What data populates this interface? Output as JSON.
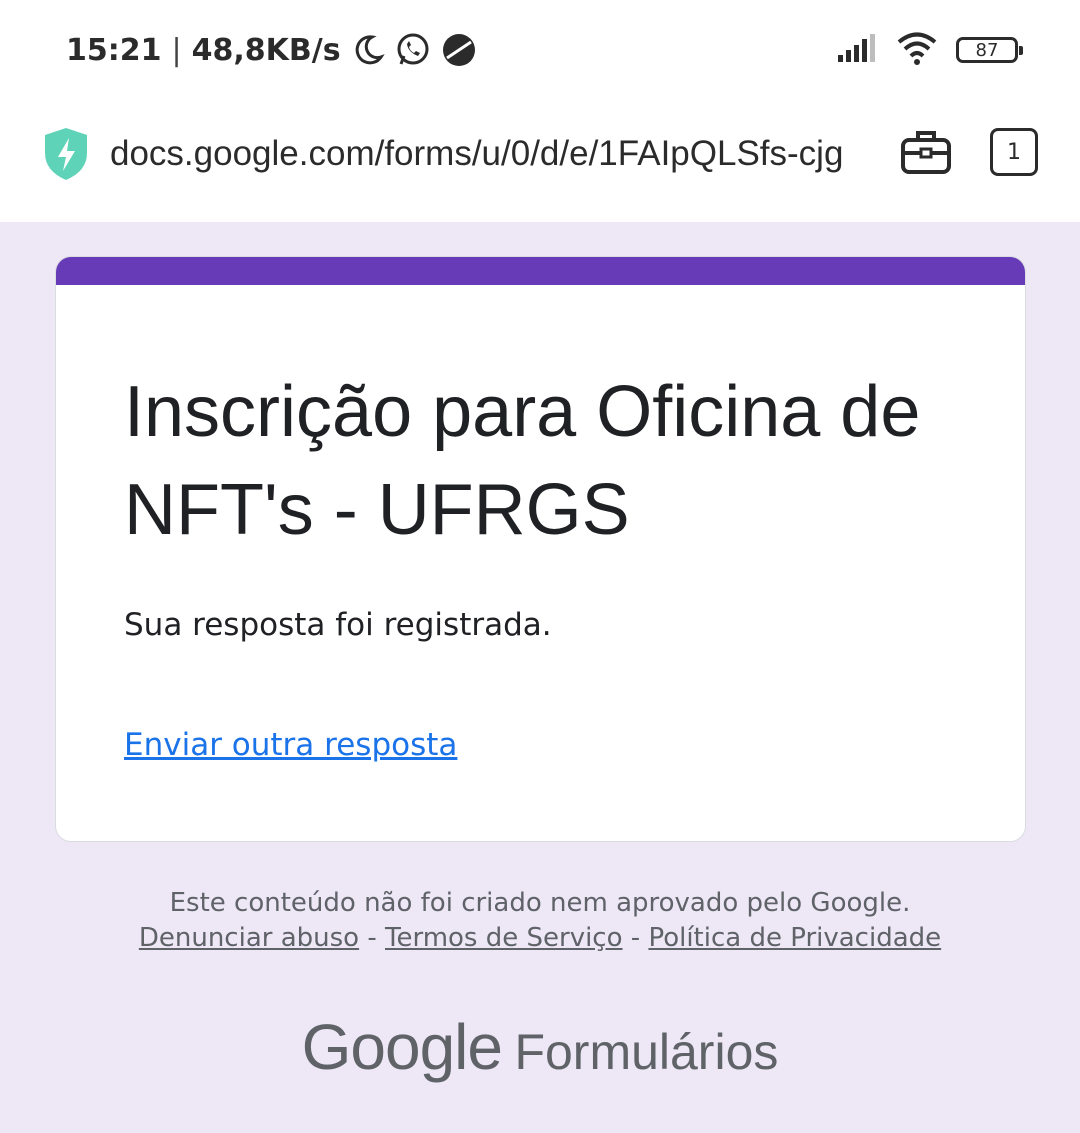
{
  "status_bar": {
    "time": "15:21",
    "separator": "|",
    "network_speed": "48,8KB/s",
    "icons": [
      "moon-icon",
      "whatsapp-icon",
      "browser-icon",
      "signal-icon",
      "wifi-icon"
    ],
    "battery": "87"
  },
  "browser": {
    "url": "docs.google.com/forms/u/0/d/e/1FAIpQLSfs-cjg",
    "tab_count": "1",
    "icons": [
      "shield-icon",
      "toolbox-icon"
    ]
  },
  "form": {
    "title": "Inscrição para Oficina de NFT's - UFRGS",
    "confirmation": "Sua resposta foi registrada.",
    "submit_another": "Enviar outra resposta",
    "accent_color": "#673ab7",
    "link_color": "#1a73e8"
  },
  "footer": {
    "disclaimer": "Este conteúdo não foi criado nem aprovado pelo Google.",
    "links": [
      "Denunciar abuso",
      "Termos de Serviço",
      "Política de Privacidade"
    ],
    "separator": "-"
  },
  "brand": {
    "google": "Google",
    "product": "Formulários"
  },
  "colors": {
    "page_background": "#ede7f6",
    "text": "#202124",
    "muted_text": "#5f6368"
  }
}
